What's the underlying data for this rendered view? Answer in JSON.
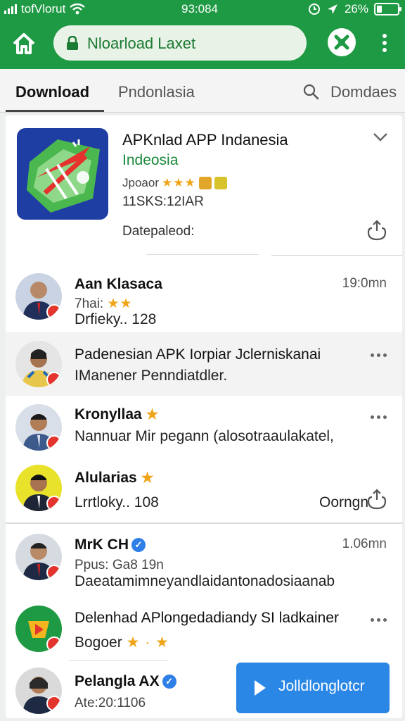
{
  "status_bar": {
    "carrier": "tofVlorut",
    "time": "93:084",
    "battery": "26%",
    "battery_level": 0.26
  },
  "browser": {
    "url": "Nloarload Laxet"
  },
  "tabs": [
    {
      "label": "Download",
      "active": true
    },
    {
      "label": "Pndonlasia",
      "active": false
    },
    {
      "label": "Domdaes",
      "active": false
    }
  ],
  "app": {
    "title": "APKnlad APP Indanesia",
    "subtitle": "Indeosia",
    "rating_label": "Jpoaor",
    "stars": "★★★",
    "size": "11SKS:12IAR",
    "date_label": "Datepaleod:"
  },
  "feed": [
    {
      "name": "Aan Klasaca",
      "line1": "7hai:",
      "stars": "★★",
      "line2": "Drfieky.. 128",
      "time": "19:0mn"
    },
    {
      "name": "Padenesian APK Iorpiar Jclerniskanai",
      "line1": "IManener Penndiatdler."
    },
    {
      "name": "Kronyllaa",
      "line1": "Nannuar Mir pegann (alosotraaulakatel,"
    },
    {
      "name": "Alularias",
      "line1": "Lrrtloky.. 108",
      "extra": "Oorngn"
    },
    {
      "name": "MrK CH",
      "line1": "Ppus: Ga8 19n",
      "line2": "Daeatamimneyandlaidantonadosiaanab",
      "time": "1.06mn"
    },
    {
      "name": "Delenhad APlongedadiandy SI ladkainer",
      "line1": "Bogoer",
      "stars": "★ · ★"
    },
    {
      "name": "Pelangla AX",
      "line1": "Ate:20:1106"
    }
  ],
  "download_button": {
    "label": "Jolldlonglotcr"
  },
  "colors": {
    "brand_green": "#1f9a44",
    "accent_blue": "#2a87e6",
    "star": "#f0a417",
    "badge_red": "#e3352e"
  },
  "icons": [
    "wifi-icon",
    "signal-icon",
    "home-icon",
    "lock-icon",
    "tools-icon",
    "more-vert-icon",
    "search-icon",
    "chevron-down-icon",
    "share-icon",
    "verified-icon",
    "play-icon"
  ]
}
